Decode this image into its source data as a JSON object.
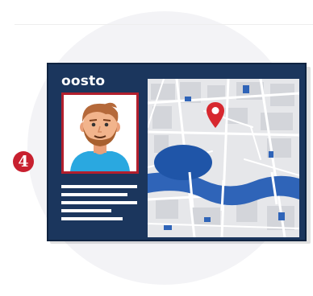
{
  "brand": {
    "logo_text": "oosto"
  },
  "step": {
    "number": "4"
  },
  "icons": {
    "person": "person-portrait-icon",
    "map": "city-map-icon",
    "pin": "location-pin-icon"
  },
  "colors": {
    "card_background": "#1b365d",
    "photo_border": "#b21f2d",
    "map_water": "#2f64b8",
    "pin": "#d7282f",
    "badge": "#c8202f",
    "map_land": "#e6e7ea"
  }
}
